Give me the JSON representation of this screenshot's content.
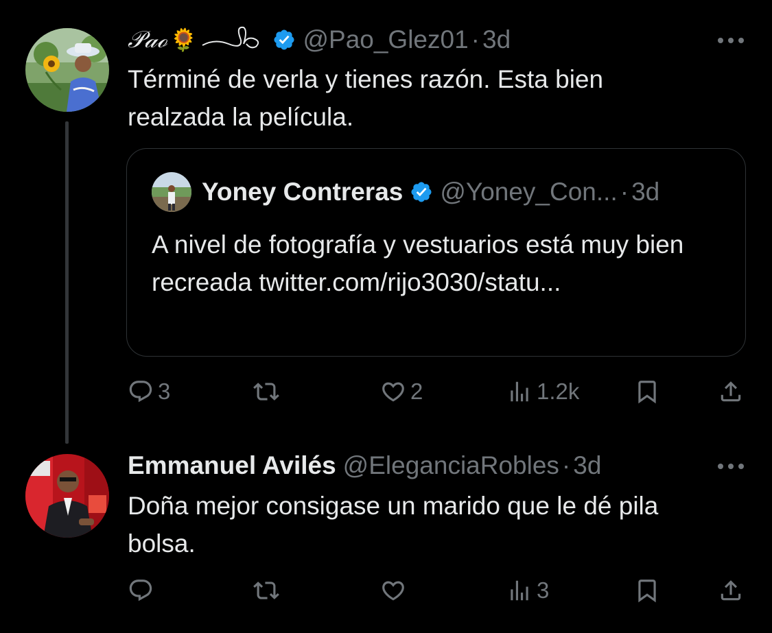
{
  "colors": {
    "background": "#000000",
    "primary_text": "#e7e9ea",
    "secondary_text": "#71767b",
    "verified_blue": "#1d9bf0",
    "border": "#2f3336",
    "thread_line": "#333639"
  },
  "tweets": [
    {
      "display_name": "𝒫𝒶ℴ",
      "name_emoji": "🌻",
      "verified": true,
      "handle": "@Pao_Glez01",
      "separator": "·",
      "time": "3d",
      "text": "Términé de verla y tienes razón. Esta bien realzada la película.",
      "quote": {
        "display_name": "Yoney Contreras",
        "verified": true,
        "handle": "@Yoney_Con...",
        "separator": "·",
        "time": "3d",
        "text": "A nivel de fotografía y vestuarios está muy bien recreada twitter.com/rijo3030/statu..."
      },
      "actions": {
        "replies": "3",
        "retweets": "",
        "likes": "2",
        "views": "1.2k"
      },
      "icons": [
        "reply-icon",
        "retweet-icon",
        "like-icon",
        "views-icon",
        "bookmark-icon",
        "share-icon",
        "more-icon"
      ]
    },
    {
      "display_name": "Emmanuel Avilés",
      "verified": false,
      "handle": "@EleganciaRobles",
      "separator": "·",
      "time": "3d",
      "text": "Doña mejor consigase un marido que le dé pila bolsa.",
      "actions": {
        "replies": "",
        "retweets": "",
        "likes": "",
        "views": "3"
      },
      "icons": [
        "reply-icon",
        "retweet-icon",
        "like-icon",
        "views-icon",
        "bookmark-icon",
        "share-icon",
        "more-icon"
      ]
    }
  ]
}
